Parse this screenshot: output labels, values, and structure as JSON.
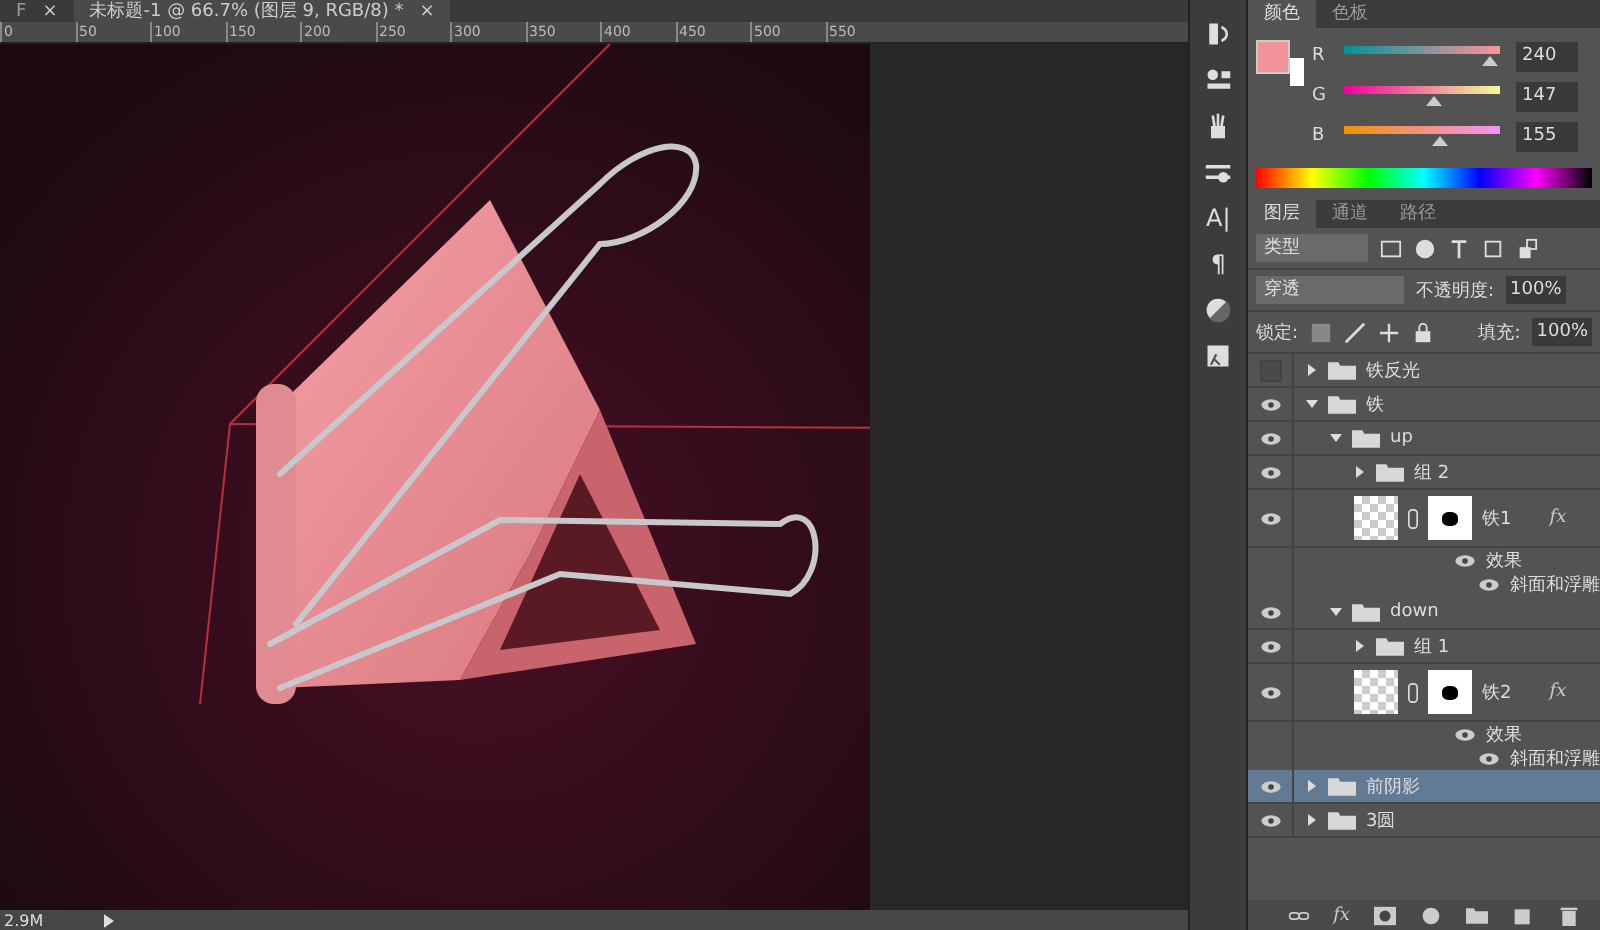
{
  "document_tabs": [
    {
      "title": "F",
      "selected": false,
      "close": "×"
    },
    {
      "title": "未标题-1 @ 66.7% (图层 9, RGB/8) *",
      "selected": true,
      "close": "×"
    }
  ],
  "ruler": {
    "ticks": [
      "0",
      "50",
      "100",
      "150",
      "200",
      "250",
      "300",
      "350",
      "400",
      "450",
      "500",
      "550"
    ]
  },
  "status_bar": {
    "doc_size": "2.9M"
  },
  "dock": {
    "character_glyph": "A|",
    "paragraph_glyph": "¶"
  },
  "color_panel": {
    "tabs": [
      {
        "label": "颜色",
        "selected": true
      },
      {
        "label": "色板",
        "selected": false
      }
    ],
    "foreground": {
      "color": "#f0939b"
    },
    "background": {
      "color": "#ffffff"
    },
    "channels": [
      {
        "name": "R",
        "value": "240",
        "level": 0.94
      },
      {
        "name": "G",
        "value": "147",
        "level": 0.58
      },
      {
        "name": "B",
        "value": "155",
        "level": 0.61
      }
    ]
  },
  "layers_panel": {
    "tabs": [
      {
        "label": "图层",
        "selected": true
      },
      {
        "label": "通道",
        "selected": false
      },
      {
        "label": "路径",
        "selected": false
      }
    ],
    "filter": "类型",
    "blend_mode": "穿透",
    "opacity_label": "不透明度:",
    "opacity": "100%",
    "lock_label": "锁定:",
    "fill_label": "填充:",
    "fill": "100%",
    "layers": [
      {
        "kind": "group",
        "name": "铁反光",
        "visible": false,
        "expanded": false,
        "selected": false
      },
      {
        "kind": "group",
        "name": "铁",
        "visible": true,
        "expanded": true,
        "selected": false,
        "children": [
          {
            "kind": "group",
            "name": "up",
            "visible": true,
            "expanded": true,
            "selected": false,
            "children": [
              {
                "kind": "group",
                "name": "组 2",
                "visible": true,
                "expanded": false,
                "selected": false
              },
              {
                "kind": "layer",
                "name": "铁1",
                "visible": true,
                "selected": false,
                "fx": "fx",
                "effects_label": "效果",
                "effects": [
                  "斜面和浮雕"
                ]
              }
            ]
          },
          {
            "kind": "group",
            "name": "down",
            "visible": true,
            "expanded": true,
            "selected": false,
            "children": [
              {
                "kind": "group",
                "name": "组 1",
                "visible": true,
                "expanded": false,
                "selected": false
              },
              {
                "kind": "layer",
                "name": "铁2",
                "visible": true,
                "selected": false,
                "fx": "fx",
                "effects_label": "效果",
                "effects": [
                  "斜面和浮雕"
                ]
              }
            ]
          }
        ]
      },
      {
        "kind": "group",
        "name": "前阴影",
        "visible": true,
        "expanded": false,
        "selected": true
      },
      {
        "kind": "group",
        "name": "3圆",
        "visible": true,
        "expanded": false,
        "selected": false
      }
    ],
    "toolbar_fx": "fx"
  }
}
